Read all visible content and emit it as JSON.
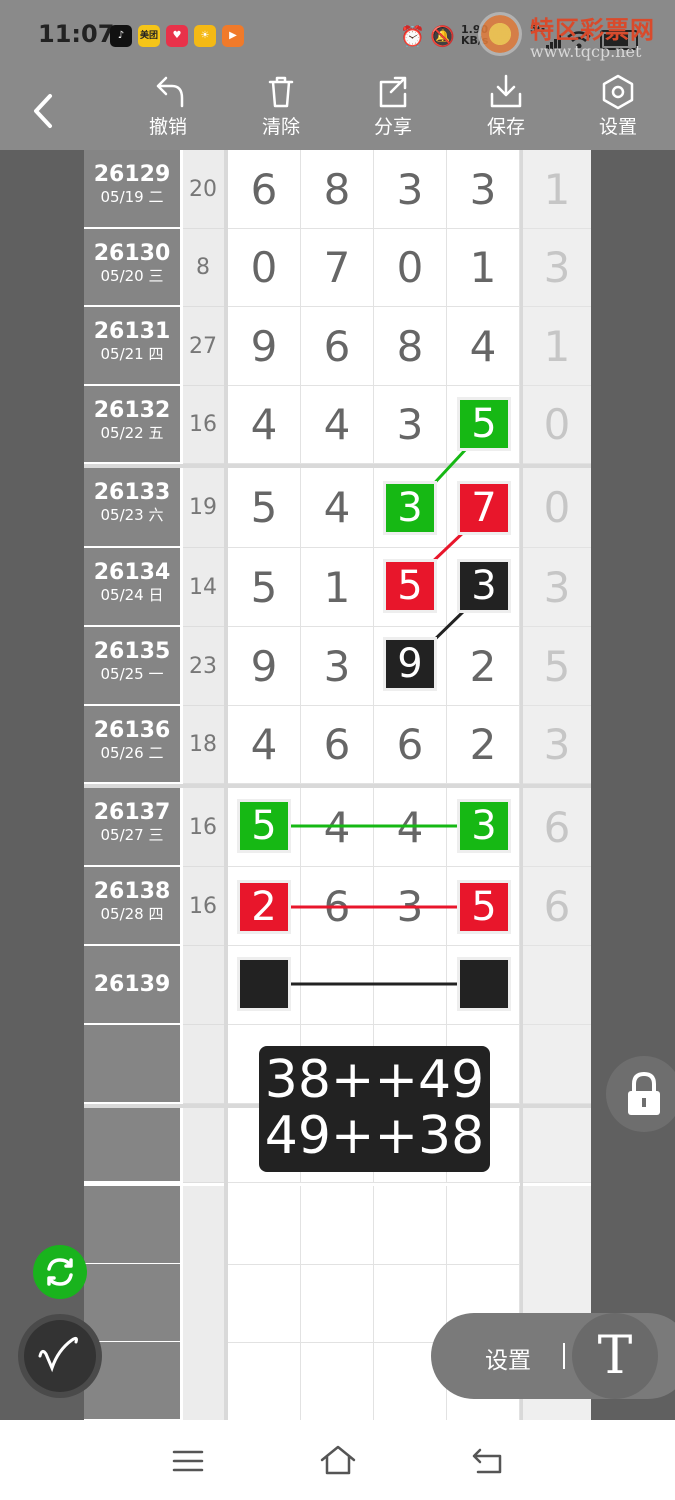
{
  "status_bar": {
    "time": "11:07",
    "apps": [
      {
        "icon": "tiktok-icon",
        "color": "#111111",
        "text": "♪"
      },
      {
        "icon": "meituan-icon",
        "color": "#f5c518",
        "text": "美团"
      },
      {
        "icon": "heart-app-icon",
        "color": "#e8324a",
        "text": "♥"
      },
      {
        "icon": "sun-app-icon",
        "color": "#f5b914",
        "text": "☀"
      },
      {
        "icon": "tv-app-icon",
        "color": "#f07a2a",
        "text": "▶"
      }
    ],
    "net_speed_value": "1.90",
    "net_speed_unit": "KB/s",
    "network": "5G",
    "watermark_title": "特区彩票网",
    "watermark_url": "www.tqcp.net"
  },
  "toolbar": {
    "undo": "撤销",
    "clear": "清除",
    "share": "分享",
    "save": "保存",
    "settings": "设置"
  },
  "rows": [
    {
      "issue": "26129",
      "date": "05/19 二",
      "sum": "20",
      "digits": [
        "6",
        "8",
        "3",
        "3"
      ],
      "last": "1"
    },
    {
      "issue": "26130",
      "date": "05/20 三",
      "sum": "8",
      "digits": [
        "0",
        "7",
        "0",
        "1"
      ],
      "last": "3"
    },
    {
      "issue": "26131",
      "date": "05/21 四",
      "sum": "27",
      "digits": [
        "9",
        "6",
        "8",
        "4"
      ],
      "last": "1"
    },
    {
      "issue": "26132",
      "date": "05/22 五",
      "sum": "16",
      "digits": [
        "4",
        "4",
        "3",
        "5"
      ],
      "last": "0"
    },
    {
      "issue": "26133",
      "date": "05/23 六",
      "sum": "19",
      "digits": [
        "5",
        "4",
        "3",
        "7"
      ],
      "last": "0"
    },
    {
      "issue": "26134",
      "date": "05/24 日",
      "sum": "14",
      "digits": [
        "5",
        "1",
        "5",
        "3"
      ],
      "last": "3"
    },
    {
      "issue": "26135",
      "date": "05/25 一",
      "sum": "23",
      "digits": [
        "9",
        "3",
        "9",
        "2"
      ],
      "last": "5"
    },
    {
      "issue": "26136",
      "date": "05/26 二",
      "sum": "18",
      "digits": [
        "4",
        "6",
        "6",
        "2"
      ],
      "last": "3"
    },
    {
      "issue": "26137",
      "date": "05/27 三",
      "sum": "16",
      "digits": [
        "5",
        "4",
        "4",
        "3"
      ],
      "last": "6"
    },
    {
      "issue": "26138",
      "date": "05/28 四",
      "sum": "16",
      "digits": [
        "2",
        "6",
        "3",
        "5"
      ],
      "last": "6"
    },
    {
      "issue": "26139",
      "date": "",
      "sum": "",
      "digits": [
        "",
        "",
        "",
        ""
      ],
      "last": ""
    }
  ],
  "formula": {
    "line1": "38++49",
    "line2": "49++38"
  },
  "floating": {
    "settings_label": "设置",
    "text_tool": "T"
  },
  "colors": {
    "green": "#16b814",
    "red": "#e8162b",
    "black": "#222222"
  }
}
